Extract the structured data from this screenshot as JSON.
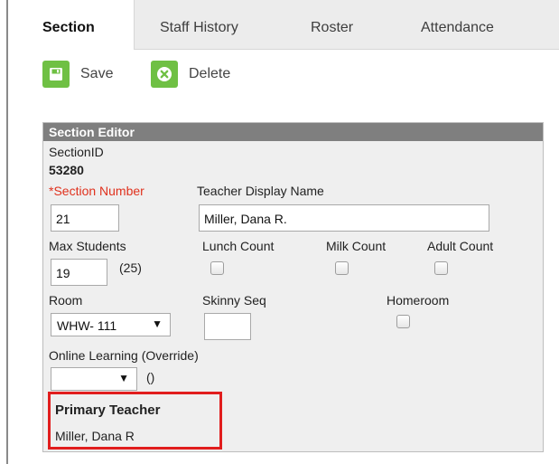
{
  "tabs": [
    {
      "label": "Section",
      "active": true
    },
    {
      "label": "Staff History",
      "active": false
    },
    {
      "label": "Roster",
      "active": false
    },
    {
      "label": "Attendance",
      "active": false
    }
  ],
  "toolbar": {
    "save_label": "Save",
    "save_icon": "save-disk-icon",
    "delete_label": "Delete",
    "delete_icon": "delete-x-icon",
    "button_color": "#6fc044"
  },
  "editor": {
    "title": "Section Editor",
    "section_id_label": "SectionID",
    "section_id_value": "53280",
    "section_number_label": "*Section Number",
    "section_number_value": "21",
    "teacher_display_name_label": "Teacher Display Name",
    "teacher_display_name_value": "Miller, Dana R.",
    "max_students_label": "Max Students",
    "max_students_value": "19",
    "max_students_capacity": "(25)",
    "lunch_count_label": "Lunch Count",
    "milk_count_label": "Milk Count",
    "adult_count_label": "Adult Count",
    "room_label": "Room",
    "room_value": "WHW- 111",
    "skinny_seq_label": "Skinny Seq",
    "skinny_seq_value": "",
    "homeroom_label": "Homeroom",
    "online_learning_label": "Online Learning (Override)",
    "online_learning_value": "",
    "online_learning_note": "()",
    "primary_teacher_label": "Primary Teacher",
    "primary_teacher_value": "Miller, Dana R",
    "required_color": "#e0311d",
    "highlight_color": "#e11d1d"
  }
}
